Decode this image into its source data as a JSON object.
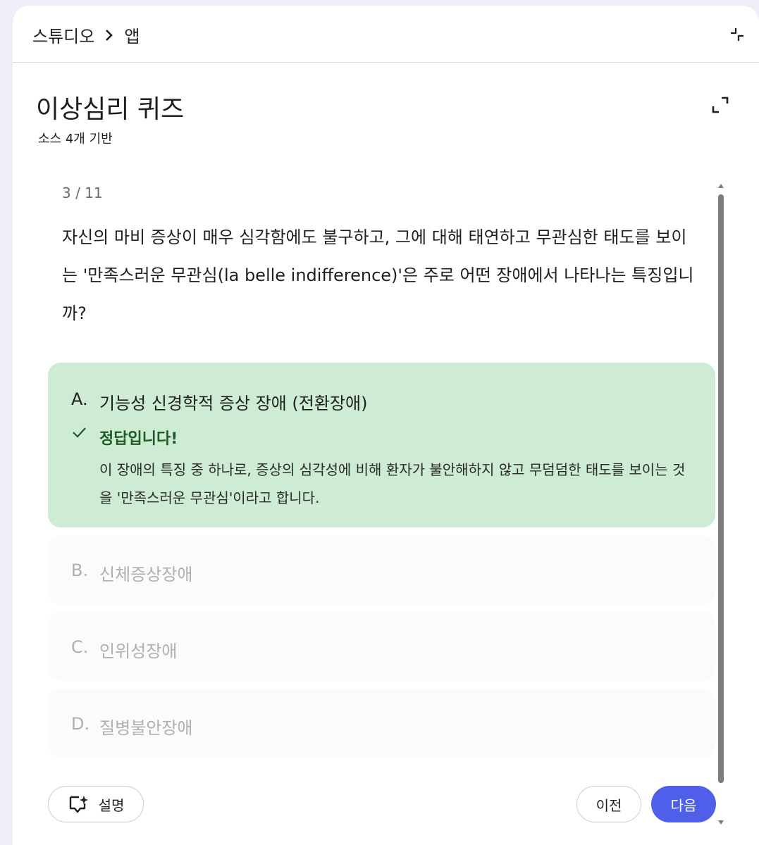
{
  "header": {
    "breadcrumb": [
      "스튜디오",
      "앱"
    ]
  },
  "quiz": {
    "title": "이상심리 퀴즈",
    "subtitle": "소스 4개 기반",
    "progress": "3 / 11",
    "question": "자신의 마비 증상이 매우 심각함에도 불구하고, 그에 대해 태연하고 무관심한 태도를 보이는 '만족스러운 무관심(la belle indifference)'은 주로 어떤 장애에서 나타나는 특징입니까?",
    "options": [
      {
        "letter": "A.",
        "text": "기능성 신경학적 증상 장애 (전환장애)"
      },
      {
        "letter": "B.",
        "text": "신체증상장애"
      },
      {
        "letter": "C.",
        "text": "인위성장애"
      },
      {
        "letter": "D.",
        "text": "질병불안장애"
      }
    ],
    "feedback": {
      "title": "정답입니다!",
      "text": "이 장애의 특징 중 하나로, 증상의 심각성에 비해 환자가 불안해하지 않고 무덤덤한 태도를 보이는 것을 '만족스러운 무관심'이라고 합니다."
    }
  },
  "buttons": {
    "explain": "설명",
    "prev": "이전",
    "next": "다음"
  },
  "colors": {
    "correct_bg": "#ceebd4",
    "accent": "#4f5fea",
    "correct_text": "#1e5b27"
  },
  "icons": [
    "chevron-right-icon",
    "collapse-icon",
    "expand-icon",
    "check-icon",
    "explain-sparkle-icon"
  ]
}
